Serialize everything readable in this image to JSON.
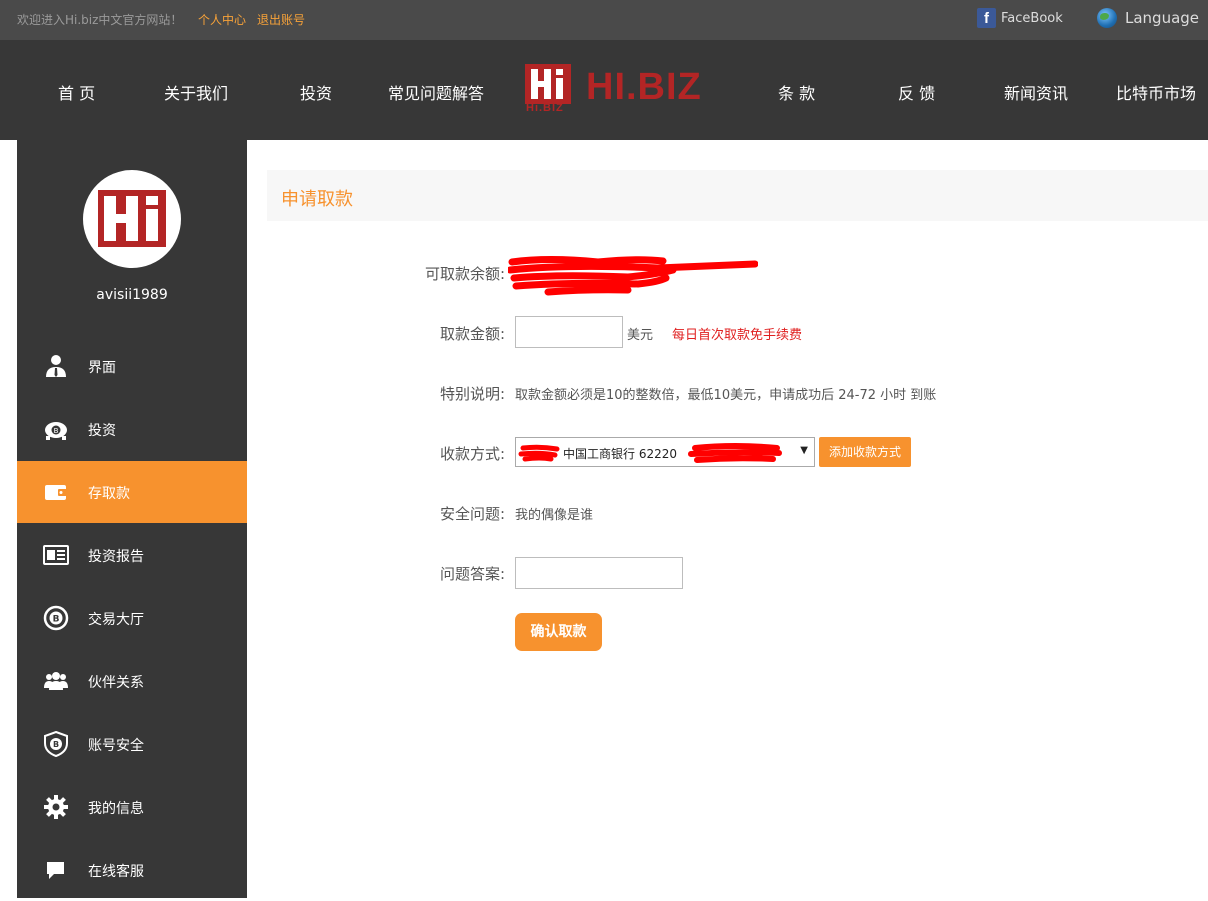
{
  "topbar": {
    "welcome": "欢迎进入Hi.biz中文官方网站！",
    "personal_center": "个人中心",
    "logout": "退出账号",
    "facebook": "FaceBook",
    "language": "Language"
  },
  "nav": {
    "items": [
      "首 页",
      "关于我们",
      "投资",
      "常见问题解答",
      "条 款",
      "反 馈",
      "新闻资讯",
      "比特币市场"
    ],
    "logo_text": "HI.BIZ",
    "logo_sub": "Hi.BIZ"
  },
  "sidebar": {
    "username": "avisii1989",
    "items": [
      {
        "label": "界面",
        "icon": "user-icon"
      },
      {
        "label": "投资",
        "icon": "piggy-bank-icon"
      },
      {
        "label": "存取款",
        "icon": "wallet-icon"
      },
      {
        "label": "投资报告",
        "icon": "report-icon"
      },
      {
        "label": "交易大厅",
        "icon": "bitcoin-exchange-icon"
      },
      {
        "label": "伙伴关系",
        "icon": "partners-icon"
      },
      {
        "label": "账号安全",
        "icon": "shield-icon"
      },
      {
        "label": "我的信息",
        "icon": "gear-icon"
      },
      {
        "label": "在线客服",
        "icon": "chat-icon"
      }
    ],
    "active_index": 2
  },
  "form": {
    "title": "申请取款",
    "balance_label": "可取款余额:",
    "amount_label": "取款金额:",
    "amount_value": "",
    "amount_unit": "美元",
    "fee_note": "每日首次取款免手续费",
    "note_label": "特别说明:",
    "note_text": "取款金额必须是10的整数倍，最低10美元，申请成功后 24-72 小时 到账",
    "method_label": "收款方式:",
    "method_selected": "中国工商银行 62220",
    "add_method": "添加收款方式",
    "security_label": "安全问题:",
    "security_question": "我的偶像是谁",
    "answer_label": "问题答案:",
    "answer_value": "",
    "submit": "确认取款"
  },
  "colors": {
    "accent": "#f7922e",
    "nav_bg": "#373737",
    "topbar_bg": "#4a4a4a",
    "logo_red": "#b32525",
    "fee_note": "#e02020"
  }
}
